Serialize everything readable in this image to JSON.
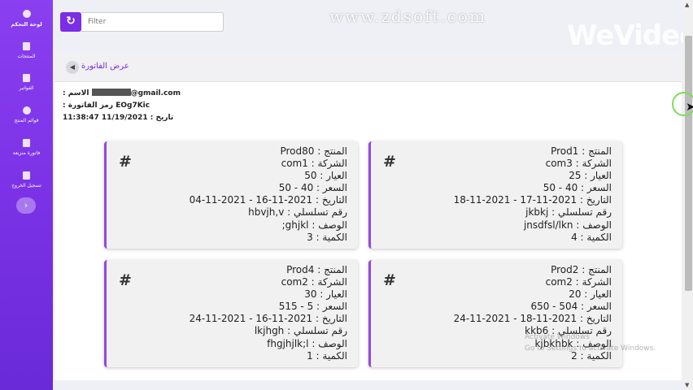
{
  "sidebar": {
    "items": [
      {
        "label": "لوحة التحكم",
        "icon": "dashboard-icon",
        "active": true
      },
      {
        "label": "المنتجات",
        "icon": "products-icon"
      },
      {
        "label": "الفواتير",
        "icon": "invoices-icon"
      },
      {
        "label": "قوائم المنتج",
        "icon": "user-icon"
      },
      {
        "label": "فاتورة منزيعة",
        "icon": "invoice-sale-icon"
      },
      {
        "label": "تسجيل الخروج",
        "icon": "logout-icon"
      }
    ],
    "toggle_glyph": "›"
  },
  "topbar": {
    "refresh_glyph": "↻",
    "filter_placeholder": "Filter"
  },
  "watermarks": {
    "zdsoft": "www.zdsoft.com",
    "wevideo": "WeVideo",
    "windows_line1": "Activate Windows",
    "windows_line2": "Go to Settings to activate Windows."
  },
  "invoice": {
    "title": "عرض الفاتورة",
    "back_glyph": "◀",
    "name_label": ": الاسم",
    "email_suffix": "@gmail.com",
    "code_label": ": رمز الفاتورة",
    "code_value": "EOg7Kic",
    "date_label": "تاريخ :",
    "date_value": "11/19/2021 11:38:47"
  },
  "cards": [
    {
      "hash": "#",
      "fields": [
        "المنتج : Prod1",
        "الشركة : com3",
        "العيار : 25",
        "السعر : 40 - 50",
        "التاريخ : 2021-11-17 - 2021-11-18",
        "رقم تسلسلي : jkbkj",
        "الوصف : jnsdfsl/lkn",
        "الكمية : 4"
      ]
    },
    {
      "hash": "#",
      "fields": [
        "المنتج : Prod80",
        "الشركة : com1",
        "العيار : 50",
        "السعر : 40 - 50",
        "التاريخ : 2021-11-16 - 2021-11-04",
        "رقم تسلسلي : hbvjh,v",
        "الوصف : ghjkl;",
        "الكمية : 3"
      ]
    },
    {
      "hash": "#",
      "fields": [
        "المنتج : Prod2",
        "الشركة : com2",
        "العيار : 20",
        "السعر : 504 - 650",
        "التاريخ : 2021-11-18 - 2021-11-24",
        "رقم تسلسلي : kkb6",
        "الوصف : kjbkhbk",
        "الكمية : 2"
      ]
    },
    {
      "hash": "#",
      "fields": [
        "المنتج : Prod4",
        "الشركة : com2",
        "العيار : 30",
        "السعر : 5 - 515",
        "التاريخ : 2021-11-16 - 2021-11-24",
        "رقم تسلسلي : lkjhgh",
        "الوصف : fhgjhjlk;l",
        "الكمية : 1"
      ]
    }
  ],
  "colors": {
    "accent": "#7a2ee6",
    "sidebar_top": "#8a3ff0",
    "card_border": "#9448e0"
  }
}
